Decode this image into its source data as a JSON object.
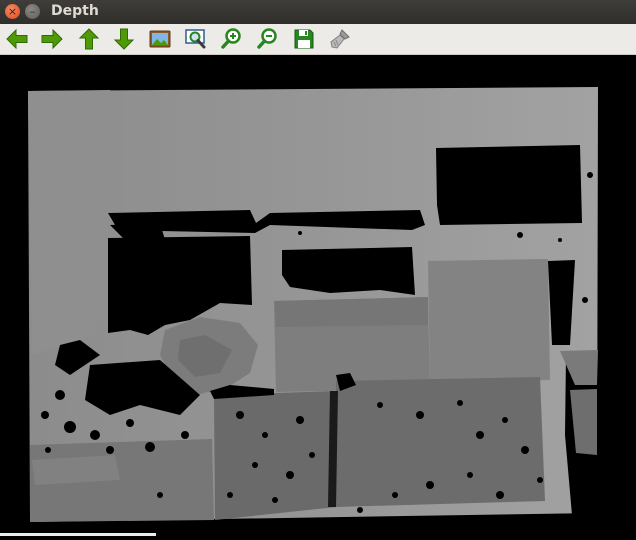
{
  "window": {
    "title": "Depth",
    "close_glyph": "×",
    "minimize_glyph": "–"
  },
  "toolbar": {
    "buttons": [
      {
        "name": "pan-left",
        "icon": "arrow-left-icon"
      },
      {
        "name": "pan-right",
        "icon": "arrow-right-icon"
      },
      {
        "name": "pan-up",
        "icon": "arrow-up-icon"
      },
      {
        "name": "pan-down",
        "icon": "arrow-down-icon"
      },
      {
        "name": "zoom-original",
        "icon": "image-icon"
      },
      {
        "name": "zoom-to-fit",
        "icon": "zoom-rect-icon"
      },
      {
        "name": "zoom-in",
        "icon": "zoom-in-icon"
      },
      {
        "name": "zoom-out",
        "icon": "zoom-out-icon"
      },
      {
        "name": "save",
        "icon": "save-icon"
      },
      {
        "name": "properties",
        "icon": "brush-icon"
      }
    ]
  },
  "colors": {
    "titlebar": "#2f2e2b",
    "toolbar": "#edebe7",
    "arrow_green": "#4f9a06",
    "save_green": "#27861f",
    "canvas_bg": "#000000"
  }
}
